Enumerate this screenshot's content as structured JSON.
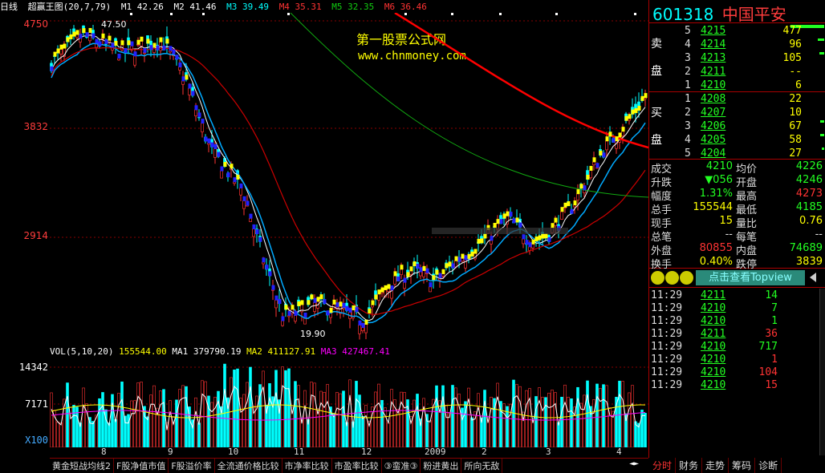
{
  "legend": {
    "period": "日线",
    "indicator": "超赢王图(20,7,79)",
    "m1": "M1  42.26",
    "m2": "M2  41.46",
    "m3": "M3  39.49",
    "m4": "M4  35.31",
    "m5": "M5  32.35",
    "m6": "M6  36.46"
  },
  "watermark": {
    "line1": "第一股票公式网",
    "line2": "www.chnmoney.com"
  },
  "y_labels": [
    "4750",
    "3832",
    "2914"
  ],
  "annotations": {
    "high": "47.50",
    "low": "19.90"
  },
  "vol_legend": {
    "name": "VOL(5,10,20)",
    "v": "155544.00",
    "ma1": "MA1  379790.19",
    "ma2": "MA2  411127.91",
    "ma3": "MA3  427467.41"
  },
  "vol_labels": [
    "14342",
    "7171",
    "X100"
  ],
  "x_labels": [
    "8",
    "9",
    "10",
    "11",
    "12",
    "2009",
    "2",
    "3",
    "4"
  ],
  "indicator_tabs": [
    "黄金短战均线2",
    "F股净值市值",
    "F股溢价率",
    "全流通价格比较",
    "市净率比较",
    "市盈率比较",
    "③蛮准③",
    "粉进黄出",
    "所向无敌"
  ],
  "stock": {
    "code": "601318",
    "name": "中国平安"
  },
  "sell_label": [
    "卖",
    "盘"
  ],
  "buy_label": [
    "买",
    "盘"
  ],
  "asks": [
    {
      "n": "5",
      "price": "4215",
      "vol": "477"
    },
    {
      "n": "4",
      "price": "4214",
      "vol": "96"
    },
    {
      "n": "3",
      "price": "4213",
      "vol": "105"
    },
    {
      "n": "2",
      "price": "4211",
      "vol": "--"
    },
    {
      "n": "1",
      "price": "4210",
      "vol": "6"
    }
  ],
  "bids": [
    {
      "n": "1",
      "price": "4208",
      "vol": "22"
    },
    {
      "n": "2",
      "price": "4207",
      "vol": "10"
    },
    {
      "n": "3",
      "price": "4206",
      "vol": "67"
    },
    {
      "n": "4",
      "price": "4205",
      "vol": "58"
    },
    {
      "n": "5",
      "price": "4204",
      "vol": "27"
    }
  ],
  "stats": [
    {
      "l": "成交",
      "v": "4210",
      "vc": "#2f2",
      "l2": "均价",
      "v2": "4226",
      "v2c": "#2f2"
    },
    {
      "l": "升跌",
      "v": "▼056",
      "vc": "#2f2",
      "l2": "开盘",
      "v2": "4246",
      "v2c": "#2f2"
    },
    {
      "l": "幅度",
      "v": "1.31%",
      "vc": "#2f2",
      "l2": "最高",
      "v2": "4273",
      "v2c": "#f33"
    },
    {
      "l": "总手",
      "v": "155544",
      "vc": "#ff0",
      "l2": "最低",
      "v2": "4185",
      "v2c": "#2f2"
    },
    {
      "l": "现手",
      "v": "15",
      "vc": "#ff0",
      "l2": "量比",
      "v2": "0.76",
      "v2c": "#ff0"
    },
    {
      "l": "总笔",
      "v": "--",
      "vc": "#ddd",
      "l2": "每笔",
      "v2": "--",
      "v2c": "#ddd"
    },
    {
      "l": "外盘",
      "v": "80855",
      "vc": "#f33",
      "l2": "内盘",
      "v2": "74689",
      "v2c": "#2f2"
    },
    {
      "l": "换手",
      "v": "0.40%",
      "vc": "#ff0",
      "l2": "跌停",
      "v2": "3839",
      "v2c": "#ff0"
    }
  ],
  "topview": "点击查看Topview",
  "ticks": [
    {
      "t": "11:29",
      "p": "4211",
      "v": "14",
      "vc": "#2f2"
    },
    {
      "t": "11:29",
      "p": "4210",
      "v": "7",
      "vc": "#2f2"
    },
    {
      "t": "11:29",
      "p": "4210",
      "v": "1",
      "vc": "#2f2"
    },
    {
      "t": "11:29",
      "p": "4211",
      "v": "36",
      "vc": "#f33"
    },
    {
      "t": "11:29",
      "p": "4210",
      "v": "717",
      "vc": "#2f2"
    },
    {
      "t": "11:29",
      "p": "4210",
      "v": "1",
      "vc": "#f33"
    },
    {
      "t": "11:29",
      "p": "4210",
      "v": "104",
      "vc": "#f33"
    },
    {
      "t": "11:29",
      "p": "4210",
      "v": "15",
      "vc": "#f33"
    }
  ],
  "bottom_tabs": [
    "分时",
    "财务",
    "走势",
    "筹码",
    "诊断"
  ]
}
